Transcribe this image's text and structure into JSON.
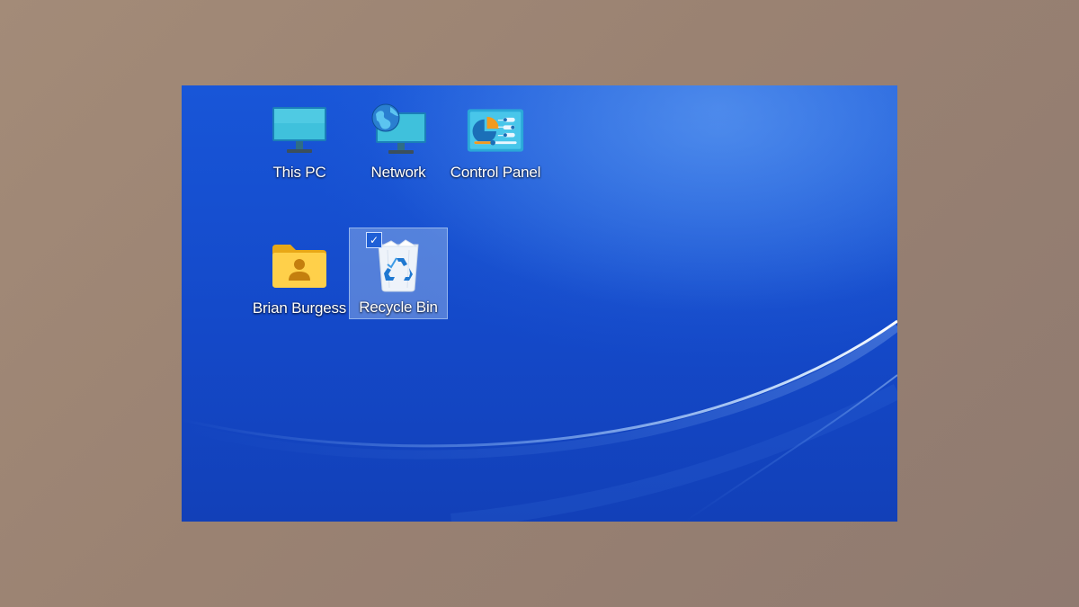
{
  "desktop": {
    "icons": [
      {
        "label": "This PC",
        "icon": "monitor-icon",
        "selected": false
      },
      {
        "label": "Network",
        "icon": "network-globe-icon",
        "selected": false
      },
      {
        "label": "Control Panel",
        "icon": "control-panel-icon",
        "selected": false
      },
      {
        "label": "Brian Burgess",
        "icon": "user-folder-icon",
        "selected": false
      },
      {
        "label": "Recycle Bin",
        "icon": "recycle-bin-icon",
        "selected": true
      }
    ],
    "selection_checkbox": "✓"
  },
  "colors": {
    "outer_background": "#9a8272",
    "wallpaper_blue": "#1449c9",
    "selection_highlight": "#a0beeb"
  }
}
